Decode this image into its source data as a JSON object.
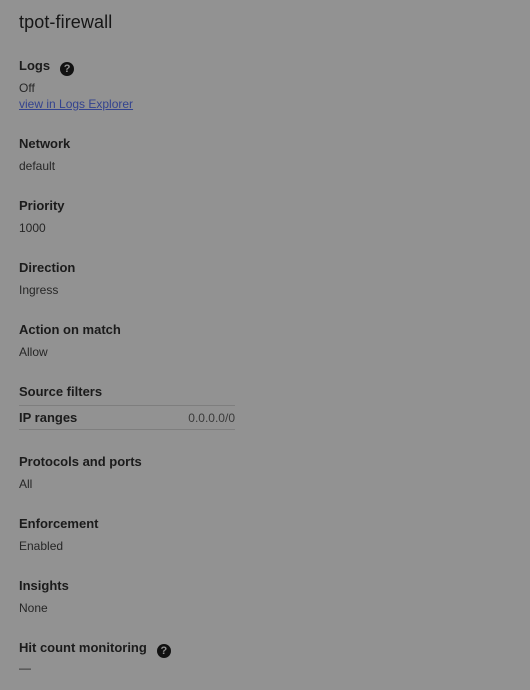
{
  "title": "tpot-firewall",
  "logs": {
    "label": "Logs",
    "value": "Off",
    "link": "view in Logs Explorer",
    "help_icon": "help-circle-icon"
  },
  "network": {
    "label": "Network",
    "value": "default"
  },
  "priority": {
    "label": "Priority",
    "value": "1000"
  },
  "direction": {
    "label": "Direction",
    "value": "Ingress"
  },
  "action": {
    "label": "Action on match",
    "value": "Allow"
  },
  "source_filters": {
    "label": "Source filters",
    "rows": [
      {
        "key": "IP ranges",
        "value": "0.0.0.0/0"
      }
    ]
  },
  "protocols": {
    "label": "Protocols and ports",
    "value": "All"
  },
  "enforcement": {
    "label": "Enforcement",
    "value": "Enabled"
  },
  "insights": {
    "label": "Insights",
    "value": "None"
  },
  "hit_count": {
    "label": "Hit count monitoring",
    "value": "—",
    "help_icon": "help-circle-icon"
  }
}
